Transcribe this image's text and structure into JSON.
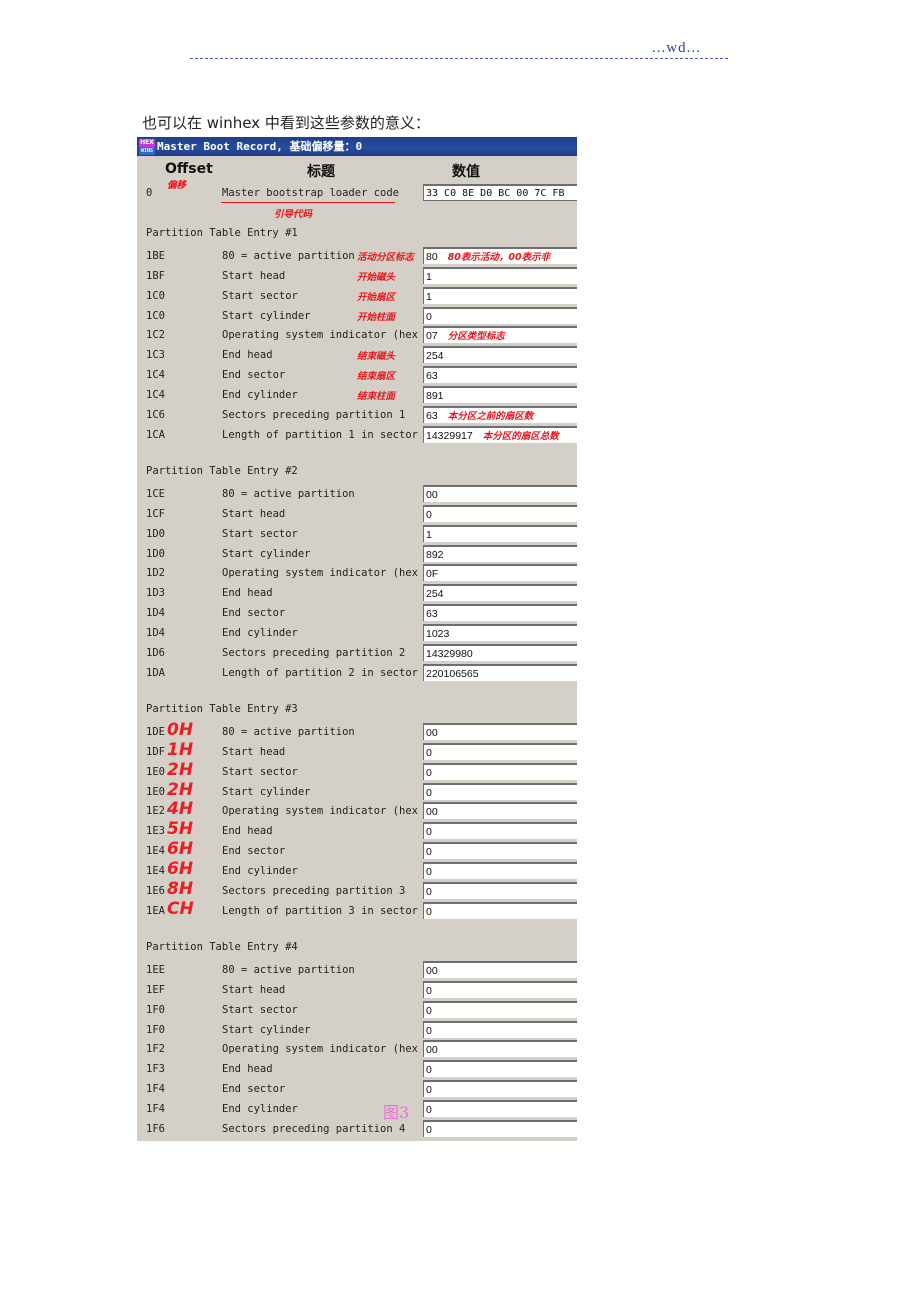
{
  "page_header": {
    "mark": "...wd..."
  },
  "intro_text": "也可以在 winhex 中看到这些参数的意义：",
  "window": {
    "title": "Master Boot Record, 基础偏移量：0",
    "icon": "winhex-icon",
    "columns": {
      "offset": "Offset",
      "title": "标题",
      "value": "数值"
    }
  },
  "boot_code": {
    "offset": "0",
    "label": "Master bootstrap loader code",
    "value": "33 C0 8E D0 BC 00 7C FB",
    "annotation_offset": "偏移",
    "annotation_label": "引导代码"
  },
  "entries": [
    {
      "title": "Partition Table Entry #1",
      "rows": [
        {
          "offset": "1BE",
          "label": "80 = active partition",
          "value": "80",
          "note": "活动分区标志",
          "value_note": "80表示活动，00表示非"
        },
        {
          "offset": "1BF",
          "label": "Start head",
          "value": "1",
          "note": "开始磁头"
        },
        {
          "offset": "1C0",
          "label": "Start sector",
          "value": "1",
          "note": "开始扇区"
        },
        {
          "offset": "1C0",
          "label": "Start cylinder",
          "value": "0",
          "note": "开始柱面"
        },
        {
          "offset": "1C2",
          "label": "Operating system indicator (hex",
          "value": "07",
          "value_note": "分区类型标志"
        },
        {
          "offset": "1C3",
          "label": "End head",
          "value": "254",
          "note": "结束磁头"
        },
        {
          "offset": "1C4",
          "label": "End sector",
          "value": "63",
          "note": "结束扇区"
        },
        {
          "offset": "1C4",
          "label": "End cylinder",
          "value": "891",
          "note": "结束柱面"
        },
        {
          "offset": "1C6",
          "label": "Sectors preceding partition 1",
          "value": "63",
          "value_note": "本分区之前的扇区数"
        },
        {
          "offset": "1CA",
          "label": "Length of partition 1 in sector",
          "value": "14329917",
          "value_note": "本分区的扇区总数"
        }
      ]
    },
    {
      "title": "Partition Table Entry #2",
      "rows": [
        {
          "offset": "1CE",
          "label": "80 = active partition",
          "value": "00"
        },
        {
          "offset": "1CF",
          "label": "Start head",
          "value": "0"
        },
        {
          "offset": "1D0",
          "label": "Start sector",
          "value": "1"
        },
        {
          "offset": "1D0",
          "label": "Start cylinder",
          "value": "892"
        },
        {
          "offset": "1D2",
          "label": "Operating system indicator (hex",
          "value": "0F"
        },
        {
          "offset": "1D3",
          "label": "End head",
          "value": "254"
        },
        {
          "offset": "1D4",
          "label": "End sector",
          "value": "63"
        },
        {
          "offset": "1D4",
          "label": "End cylinder",
          "value": "1023"
        },
        {
          "offset": "1D6",
          "label": "Sectors preceding partition 2",
          "value": "14329980"
        },
        {
          "offset": "1DA",
          "label": "Length of partition 2 in sector",
          "value": "220106565"
        }
      ]
    },
    {
      "title": "Partition Table Entry #3",
      "rows": [
        {
          "offset": "1DE",
          "rel": "0H",
          "label": "80 = active partition",
          "value": "00"
        },
        {
          "offset": "1DF",
          "rel": "1H",
          "label": "Start head",
          "value": "0"
        },
        {
          "offset": "1E0",
          "rel": "2H",
          "label": "Start sector",
          "value": "0"
        },
        {
          "offset": "1E0",
          "rel": "2H",
          "label": "Start cylinder",
          "value": "0"
        },
        {
          "offset": "1E2",
          "rel": "4H",
          "label": "Operating system indicator (hex",
          "value": "00"
        },
        {
          "offset": "1E3",
          "rel": "5H",
          "label": "End head",
          "value": "0"
        },
        {
          "offset": "1E4",
          "rel": "6H",
          "label": "End sector",
          "value": "0"
        },
        {
          "offset": "1E4",
          "rel": "6H",
          "label": "End cylinder",
          "value": "0"
        },
        {
          "offset": "1E6",
          "rel": "8H",
          "label": "Sectors preceding partition 3",
          "value": "0"
        },
        {
          "offset": "1EA",
          "rel": "CH",
          "label": "Length of partition 3 in sector",
          "value": "0"
        }
      ]
    },
    {
      "title": "Partition Table Entry #4",
      "rows": [
        {
          "offset": "1EE",
          "label": "80 = active partition",
          "value": "00"
        },
        {
          "offset": "1EF",
          "label": "Start head",
          "value": "0"
        },
        {
          "offset": "1F0",
          "label": "Start sector",
          "value": "0"
        },
        {
          "offset": "1F0",
          "label": "Start cylinder",
          "value": "0"
        },
        {
          "offset": "1F2",
          "label": "Operating system indicator (hex",
          "value": "00"
        },
        {
          "offset": "1F3",
          "label": "End head",
          "value": "0"
        },
        {
          "offset": "1F4",
          "label": "End sector",
          "value": "0"
        },
        {
          "offset": "1F4",
          "label": "End cylinder",
          "value": "0"
        },
        {
          "offset": "1F6",
          "label": "Sectors preceding partition 4",
          "value": "0"
        }
      ]
    }
  ],
  "figure_label": "图3"
}
